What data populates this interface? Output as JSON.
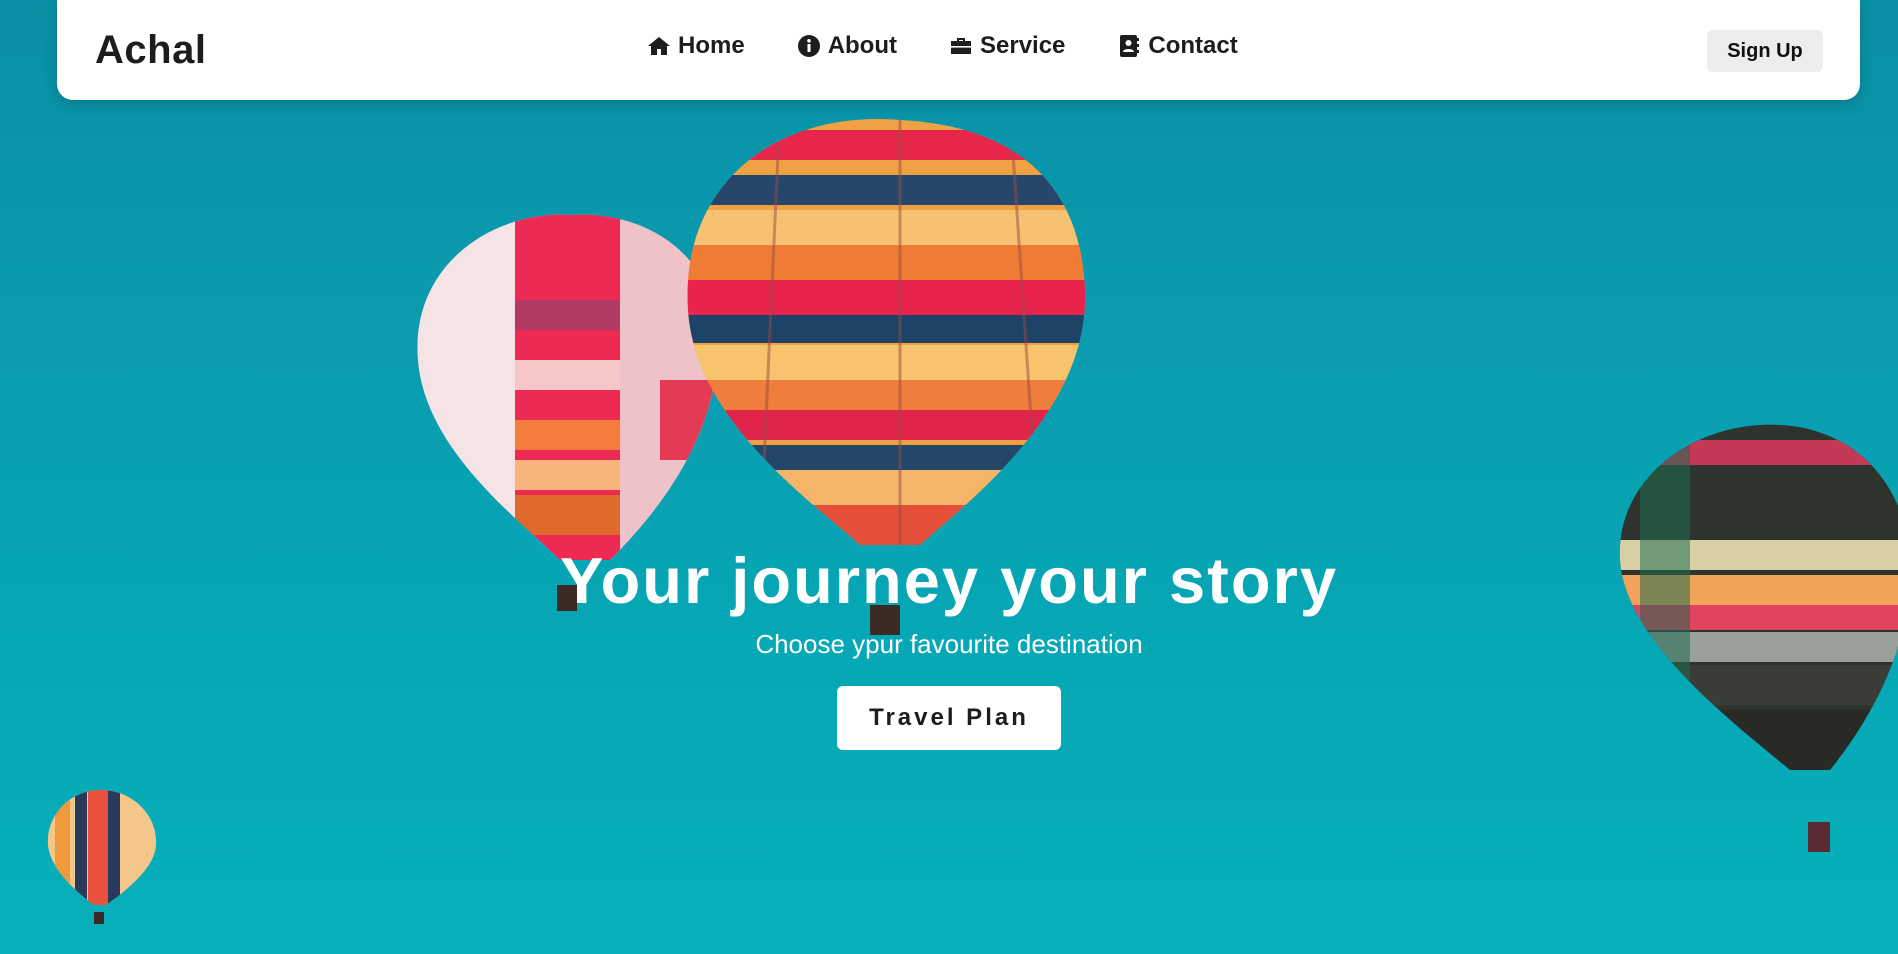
{
  "navbar": {
    "brand": "Achal",
    "links": [
      {
        "label": "Home",
        "icon": "home-icon"
      },
      {
        "label": "About",
        "icon": "info-icon"
      },
      {
        "label": "Service",
        "icon": "briefcase-icon"
      },
      {
        "label": "Contact",
        "icon": "contact-book-icon"
      }
    ],
    "signup_label": "Sign Up"
  },
  "hero": {
    "title": "Your journey your story",
    "subtitle": "Choose ypur favourite destination",
    "cta_label": "Travel Plan",
    "background_color": "#07a2b1"
  }
}
